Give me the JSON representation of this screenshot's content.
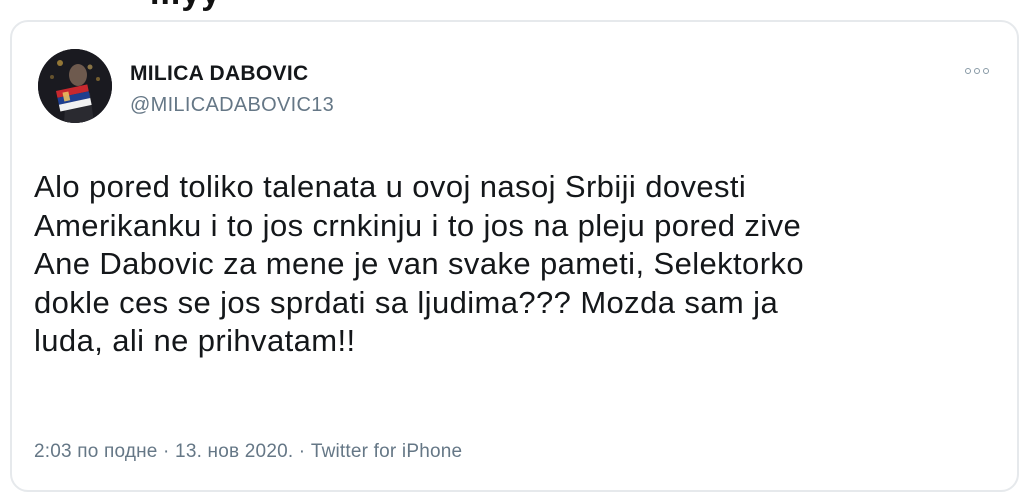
{
  "header_cut_text": "...уу",
  "tweet": {
    "author_name": "MILICA DABOVIC",
    "author_handle": "@MILICADABOVIC13",
    "text": "Alo pored toliko talenata u ovoj nasoj Srbiji dovesti\nAmerikanku i to jos crnkinju i to jos na pleju pored zive\nAne Dabovic za mene je van svake pameti, Selektorko\ndokle ces se jos sprdati sa ljudima??? Mozda sam ja\nluda, ali ne prihvatam!!",
    "meta": "2:03 по подне · 13. нов 2020. · Twitter for iPhone"
  },
  "icons": {
    "more": "more-options-icon",
    "avatar": "profile-avatar"
  }
}
